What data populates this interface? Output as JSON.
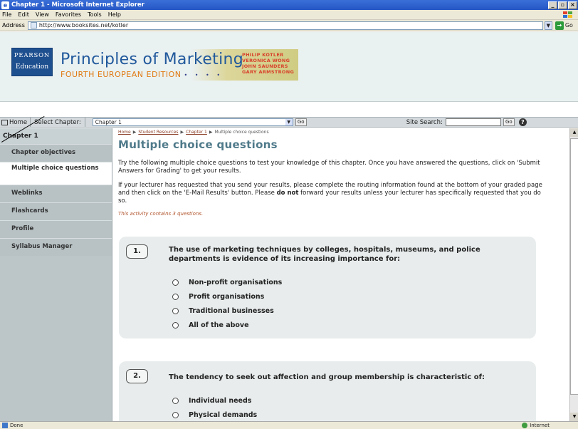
{
  "window": {
    "title": "Chapter 1 - Microsoft Internet Explorer",
    "controls": [
      "_",
      "̆",
      "×"
    ]
  },
  "menu": [
    "File",
    "Edit",
    "View",
    "Favorites",
    "Tools",
    "Help"
  ],
  "address": {
    "label": "Address",
    "url": "http://www.booksites.net/kotler",
    "go_label": "Go"
  },
  "banner": {
    "publisher_top": "PEARSON",
    "publisher_bottom": "Education",
    "title": "Principles of Marketing",
    "edition": "FOURTH EUROPEAN EDITION",
    "authors": [
      "PHILIP KOTLER",
      "VERONICA WONG",
      "JOHN SAUNDERS",
      "GARY ARMSTRONG"
    ]
  },
  "toolbar": {
    "home": "Home",
    "select_chapter": "Select Chapter:",
    "selected_chapter": "Chapter 1",
    "go": "Go",
    "site_search": "Site Search:",
    "search_go": "Go",
    "help": "?"
  },
  "sidebar": {
    "heading": "Chapter 1",
    "items": [
      {
        "label": "Chapter objectives"
      },
      {
        "label": "Multiple choice questions"
      },
      {
        "label": "Weblinks"
      },
      {
        "label": "Flashcards"
      },
      {
        "label": "Profile"
      },
      {
        "label": "Syllabus Manager"
      }
    ]
  },
  "content": {
    "breadcrumb": [
      "Home",
      "Student Resources",
      "Chapter 1",
      "Multiple choice questions"
    ],
    "title": "Multiple choice questions",
    "intro": "Try the following multiple choice questions to test your knowledge of this chapter. Once you have answered the questions, click on 'Submit Answers for Grading' to get your results.",
    "lecturer_note_before": "If your lecturer has requested that you send your results, please complete the routing information found at the bottom of your graded page and then click on the 'E-Mail Results' button. Please ",
    "lecturer_note_bold": "do not",
    "lecturer_note_after": " forward your results unless your lecturer has specifically requested that you do so.",
    "activity_note": "This activity contains 3 questions."
  },
  "questions": [
    {
      "number": "1.",
      "text": "The use of marketing techniques by colleges, hospitals, museums, and police departments is evidence of its increasing importance for:",
      "options": [
        "Non-profit organisations",
        "Profit organisations",
        "Traditional businesses",
        "All of the above"
      ]
    },
    {
      "number": "2.",
      "text": "The tendency to seek out affection and group membership is characteristic of:",
      "options": [
        "Individual needs",
        "Physical demands"
      ]
    }
  ],
  "status": {
    "text": "Done",
    "zone": "Internet"
  },
  "colors": {
    "title_blue": "#21599c",
    "edition_orange": "#e07b14",
    "heading_teal": "#4f7a8a",
    "sidebar_bg": "#bcc6c9"
  }
}
